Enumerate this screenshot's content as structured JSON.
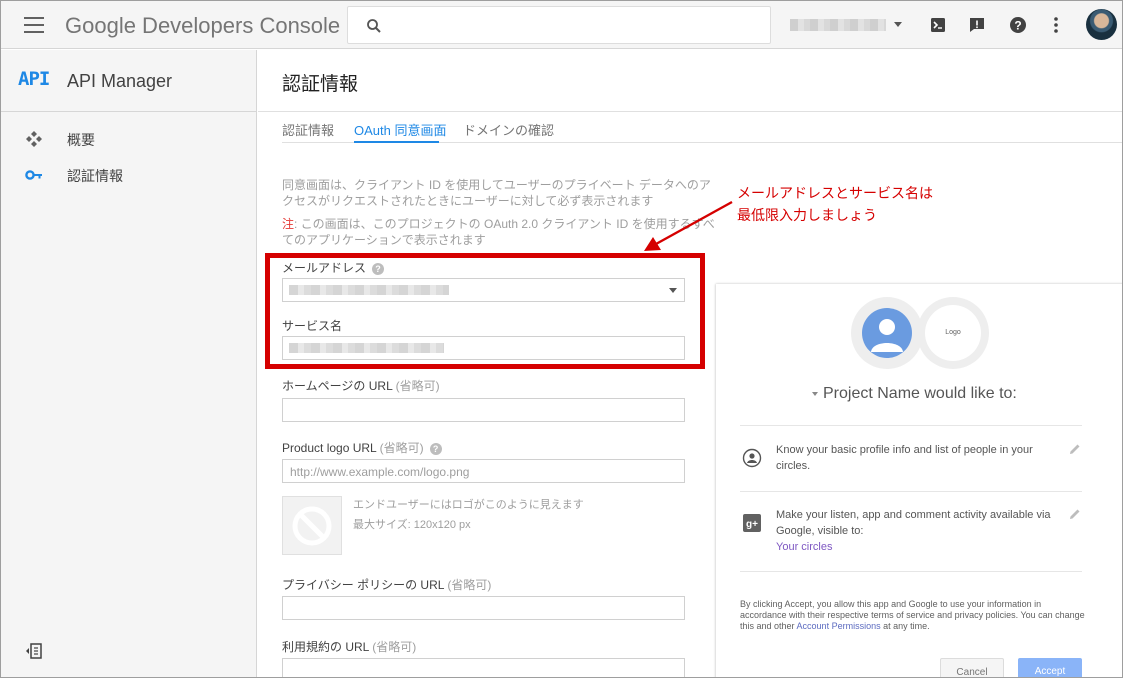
{
  "topbar": {
    "brand": "Google Developers Console",
    "search_placeholder": ""
  },
  "sidebar": {
    "api_logo": "API",
    "title": "API Manager",
    "items": [
      {
        "label": "概要",
        "icon": "overview-icon"
      },
      {
        "label": "認証情報",
        "icon": "key-icon"
      }
    ]
  },
  "main": {
    "title": "認証情報",
    "tabs": [
      {
        "label": "認証情報",
        "active": false
      },
      {
        "label": "OAuth 同意画面",
        "active": true
      },
      {
        "label": "ドメインの確認",
        "active": false
      }
    ],
    "description": "同意画面は、クライアント ID を使用してユーザーのプライベート データへのアクセスがリクエストされたときにユーザーに対して必ず表示されます",
    "note_prefix": "注",
    "note_text": ": この画面は、このプロジェクトの OAuth 2.0 クライアント ID を使用するすべてのアプリケーションで表示されます",
    "fields": {
      "email_label": "メールアドレス",
      "service_label": "サービス名",
      "homepage_label": "ホームページの URL",
      "homepage_optional": "(省略可)",
      "logo_label": "Product logo URL",
      "logo_optional": "(省略可)",
      "logo_placeholder": "http://www.example.com/logo.png",
      "logo_help_1": "エンドユーザーにはロゴがこのように見えます",
      "logo_help_2": "最大サイズ: 120x120 px",
      "privacy_label": "プライバシー ポリシーの URL",
      "privacy_optional": "(省略可)",
      "terms_label": "利用規約の URL",
      "terms_optional": "(省略可)"
    }
  },
  "annotation": {
    "callout_line1": "メールアドレスとサービス名は",
    "callout_line2": "最低限入力しましょう",
    "color": "#d50000"
  },
  "preview": {
    "logo_text": "Logo",
    "title": "Project Name would like to:",
    "permissions": [
      {
        "text": "Know your basic profile info and list of people in your circles.",
        "link": ""
      },
      {
        "text": "Make your listen, app and comment activity available via Google, visible to:",
        "link": "Your circles"
      }
    ],
    "disclaimer_pre": "By clicking Accept, you allow this app and Google to use your information in accordance with their respective terms of service and privacy policies. You can change this and other ",
    "disclaimer_link": "Account Permissions",
    "disclaimer_post": " at any time.",
    "cancel": "Cancel",
    "accept": "Accept"
  },
  "colors": {
    "accent": "#1e88e5",
    "annotation_red": "#d50000",
    "accept_button": "#8ab4f8"
  }
}
